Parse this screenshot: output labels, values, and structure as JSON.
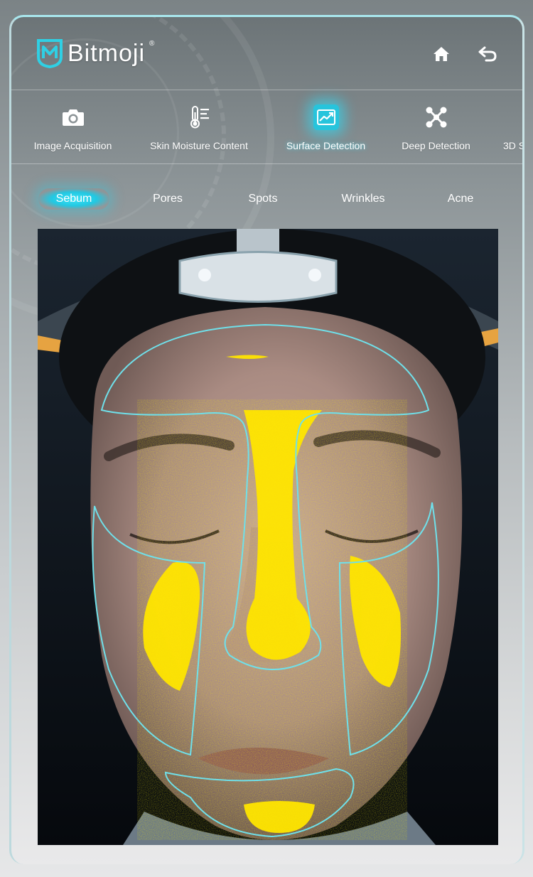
{
  "app": {
    "brand": "Bitmoji",
    "reg_mark": "®"
  },
  "header": {
    "home_icon": "home-icon",
    "back_icon": "back-arrow-icon"
  },
  "main_tabs": [
    {
      "label": "Image Acquisition",
      "icon": "camera-icon",
      "active": false
    },
    {
      "label": "Skin Moisture Content",
      "icon": "thermometer-icon",
      "active": false
    },
    {
      "label": "Surface Detection",
      "icon": "image-chart-icon",
      "active": true
    },
    {
      "label": "Deep Detection",
      "icon": "molecule-icon",
      "active": false
    },
    {
      "label": "3D S",
      "icon": "",
      "active": false
    }
  ],
  "sub_tabs": [
    {
      "label": "Sebum",
      "active": true
    },
    {
      "label": "Pores",
      "active": false
    },
    {
      "label": "Spots",
      "active": false
    },
    {
      "label": "Wrinkles",
      "active": false
    },
    {
      "label": "Acne",
      "active": false
    }
  ],
  "colors": {
    "accent": "#27c4dc",
    "sebum_overlay": "#ffe400",
    "zone_outline": "#6fe0ea"
  }
}
